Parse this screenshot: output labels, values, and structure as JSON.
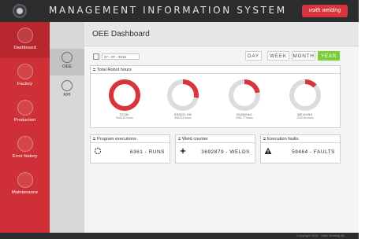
{
  "app": {
    "title": "MANAGEMENT INFORMATION SYSTEM",
    "brand": "voith welding"
  },
  "sidebar": {
    "items": [
      {
        "label": "Dashboard",
        "icon": "gauge-icon"
      },
      {
        "label": "Factory",
        "icon": "factory-icon"
      },
      {
        "label": "Production",
        "icon": "gear-icon"
      },
      {
        "label": "Error history",
        "icon": "warning-icon"
      },
      {
        "label": "Maintenance",
        "icon": "wrench-icon"
      }
    ],
    "active_index": 0
  },
  "subnav": {
    "items": [
      {
        "label": "OEE",
        "icon": "gauge-icon"
      },
      {
        "label": "KPI",
        "icon": "kpi-icon"
      }
    ],
    "active_index": 0
  },
  "header": {
    "title": "OEE Dashboard"
  },
  "date_filter": {
    "value": "27 - 07 - 2015"
  },
  "periods": {
    "day": "DAY",
    "week": "WEEK",
    "month": "MONTH",
    "year": "YEAR",
    "selected": "YEAR"
  },
  "robot_hours": {
    "title": "Total Robot hours",
    "donuts": [
      {
        "name": "TOTAL",
        "value": "9446.52 hours",
        "fill": 1.0
      },
      {
        "name": "SERVO-ON",
        "value": "2604.11 hours",
        "fill": 0.28
      },
      {
        "name": "RUNNING",
        "value": "2061.77 hours",
        "fill": 0.22
      },
      {
        "name": "WELDING",
        "value": "1263.64 hours",
        "fill": 0.13
      }
    ]
  },
  "stats": {
    "program_executions": {
      "title": "Program executions",
      "value": "6361 - RUNS",
      "icon": "spinner-icon"
    },
    "weld_counter": {
      "title": "Weld counter",
      "value": "3692879 - WELDS",
      "icon": "spark-icon"
    },
    "execution_faults": {
      "title": "Execution faults",
      "value": "59464 - FAULTS",
      "icon": "warning-icon"
    }
  },
  "footer": {
    "text": "Copyright 2015 - Voith Welding By"
  },
  "colors": {
    "accent_red": "#d8343c",
    "sidebar_red": "#cf2f37",
    "active_green": "#7ccf3b",
    "donut_track": "#dcdcdc"
  }
}
